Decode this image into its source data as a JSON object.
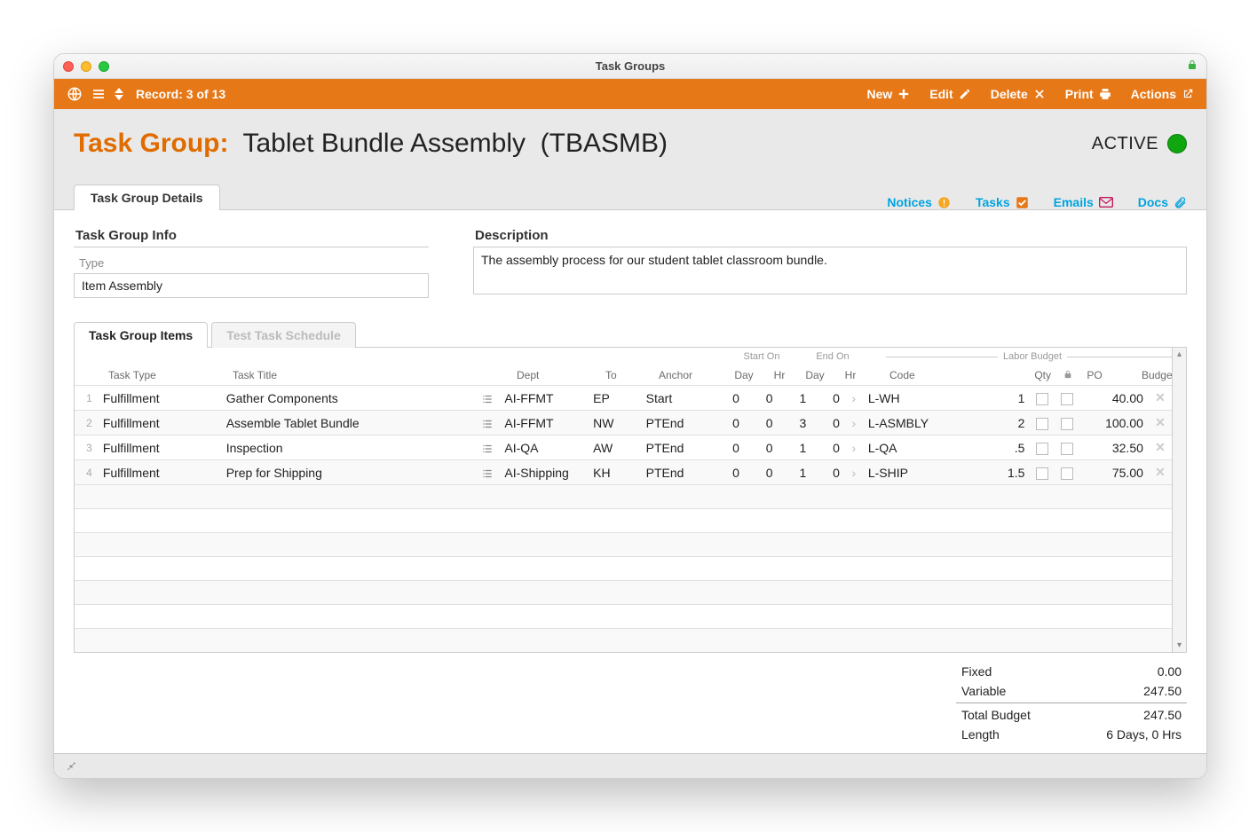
{
  "window_title": "Task Groups",
  "toolbar": {
    "record_label": "Record: 3 of 13",
    "new": "New",
    "edit": "Edit",
    "delete": "Delete",
    "print": "Print",
    "actions": "Actions"
  },
  "header": {
    "label": "Task Group:",
    "name": "Tablet Bundle Assembly",
    "code": "(TBASMB)",
    "status": "ACTIVE"
  },
  "main_tab": "Task Group Details",
  "links": {
    "notices": "Notices",
    "tasks": "Tasks",
    "emails": "Emails",
    "docs": "Docs"
  },
  "info": {
    "section_label": "Task Group Info",
    "type_label": "Type",
    "type_value": "Item Assembly",
    "desc_label": "Description",
    "desc_value": "The assembly process for our student tablet classroom bundle."
  },
  "inner_tabs": {
    "active": "Task Group Items",
    "inactive": "Test Task Schedule"
  },
  "columns": {
    "task_type": "Task Type",
    "task_title": "Task Title",
    "dept": "Dept",
    "to": "To",
    "anchor": "Anchor",
    "start_on": "Start On",
    "end_on": "End On",
    "day": "Day",
    "hr": "Hr",
    "code": "Code",
    "qty": "Qty",
    "po": "PO",
    "budget": "Budget",
    "labor_budget": "Labor Budget"
  },
  "rows": [
    {
      "idx": "1",
      "type": "Fulfillment",
      "title": "Gather Components",
      "dept": "AI-FFMT",
      "to": "EP",
      "anchor": "Start",
      "sd": "0",
      "sh": "0",
      "ed": "1",
      "eh": "0",
      "code": "L-WH",
      "qty": "1",
      "budget": "40.00"
    },
    {
      "idx": "2",
      "type": "Fulfillment",
      "title": "Assemble Tablet Bundle",
      "dept": "AI-FFMT",
      "to": "NW",
      "anchor": "PTEnd",
      "sd": "0",
      "sh": "0",
      "ed": "3",
      "eh": "0",
      "code": "L-ASMBLY",
      "qty": "2",
      "budget": "100.00"
    },
    {
      "idx": "3",
      "type": "Fulfillment",
      "title": "Inspection",
      "dept": "AI-QA",
      "to": "AW",
      "anchor": "PTEnd",
      "sd": "0",
      "sh": "0",
      "ed": "1",
      "eh": "0",
      "code": "L-QA",
      "qty": ".5",
      "budget": "32.50"
    },
    {
      "idx": "4",
      "type": "Fulfillment",
      "title": "Prep for Shipping",
      "dept": "AI-Shipping",
      "to": "KH",
      "anchor": "PTEnd",
      "sd": "0",
      "sh": "0",
      "ed": "1",
      "eh": "0",
      "code": "L-SHIP",
      "qty": "1.5",
      "budget": "75.00"
    }
  ],
  "summary": {
    "fixed_label": "Fixed",
    "fixed": "0.00",
    "variable_label": "Variable",
    "variable": "247.50",
    "total_label": "Total Budget",
    "total": "247.50",
    "length_label": "Length",
    "length": "6 Days, 0 Hrs"
  }
}
